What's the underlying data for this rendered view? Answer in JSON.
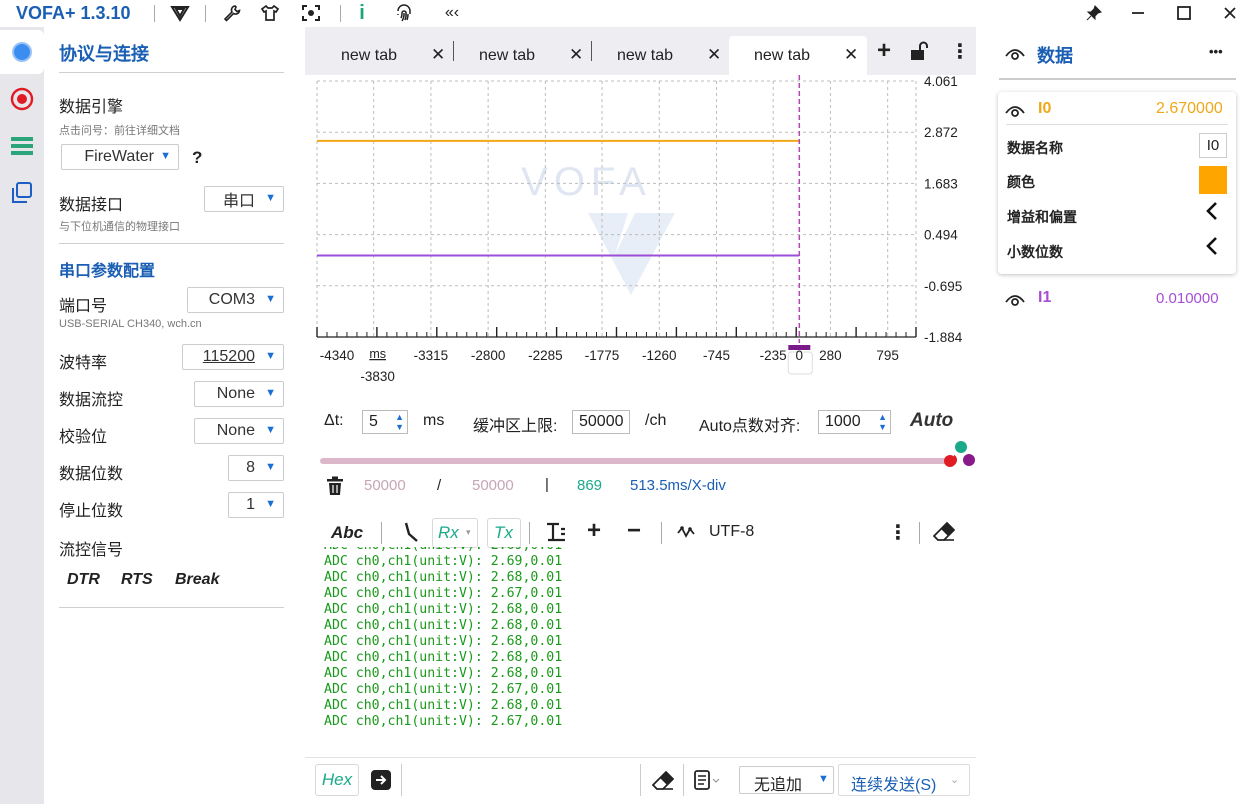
{
  "app": {
    "title": "VOFA+ 1.3.10"
  },
  "window": {
    "pin_icon": "pin-icon",
    "minimize_icon": "minimize-icon",
    "maximize_icon": "maximize-icon",
    "close_icon": "close-icon"
  },
  "left": {
    "section_title": "协议与连接",
    "engine_label": "数据引擎",
    "engine_hint": "点击问号：前往详细文档",
    "engine_value": "FireWater",
    "engine_help": "?",
    "interface_label": "数据接口",
    "interface_value": "串口",
    "interface_hint": "与下位机通信的物理接口",
    "serial_section": "串口参数配置",
    "port_label": "端口号",
    "port_value": "COM3",
    "port_hint": "USB-SERIAL CH340, wch.cn",
    "baud_label": "波特率",
    "baud_value": "115200",
    "flow_label": "数据流控",
    "flow_value": "None",
    "parity_label": "校验位",
    "parity_value": "None",
    "databits_label": "数据位数",
    "databits_value": "8",
    "stopbits_label": "停止位数",
    "stopbits_value": "1",
    "signal_label": "流控信号",
    "signals": [
      "DTR",
      "RTS",
      "Break"
    ]
  },
  "tabs": [
    {
      "label": "new tab",
      "active": false
    },
    {
      "label": "new tab",
      "active": false
    },
    {
      "label": "new tab",
      "active": false
    },
    {
      "label": "new tab",
      "active": true
    }
  ],
  "tab_actions": {
    "add": "+",
    "lock_icon": "unlock-icon",
    "more": "⋮"
  },
  "chart_data": {
    "type": "line",
    "watermark": "VOFA",
    "xlabel": "ms",
    "x_ticks": [
      "-4340",
      "-3830",
      "-3315",
      "-2800",
      "-2285",
      "-1775",
      "-1260",
      "-745",
      "-235",
      "0",
      "280",
      "795"
    ],
    "y_ticks": [
      "4.061",
      "2.872",
      "1.683",
      "0.494",
      "-0.695",
      "-1.884"
    ],
    "ylim": [
      -1.884,
      4.061
    ],
    "xlim": [
      -4340,
      1050
    ],
    "cursor_x": 0,
    "grid": true,
    "series": [
      {
        "name": "I0",
        "color": "#f0a818",
        "x": [
          -4340,
          0
        ],
        "values": [
          2.67,
          2.67
        ]
      },
      {
        "name": "I1",
        "color": "#9b4fd6",
        "x": [
          -4340,
          0
        ],
        "values": [
          0.01,
          0.01
        ]
      }
    ]
  },
  "controls": {
    "dt_label": "Δt:",
    "dt_value": "5",
    "dt_unit": "ms",
    "buffer_label": "缓冲区上限:",
    "buffer_value": "50000",
    "buffer_unit": "/ch",
    "auto_label": "Auto点数对齐:",
    "auto_value": "1000",
    "auto_button": "Auto"
  },
  "stats": {
    "count_a": "50000",
    "slash": "/",
    "count_b": "50000",
    "bar": "|",
    "points": "869",
    "rate": "513.5ms/X-div"
  },
  "console_toolbar": {
    "abc": "Abc",
    "rx": "Rx",
    "tx": "Tx",
    "plus": "+",
    "minus": "−",
    "encoding": "UTF-8"
  },
  "console": {
    "lines": [
      "ADC ch0,ch1(unit:V): 2.69,0.01",
      "ADC ch0,ch1(unit:V): 2.68,0.01",
      "ADC ch0,ch1(unit:V): 2.67,0.01",
      "ADC ch0,ch1(unit:V): 2.68,0.01",
      "ADC ch0,ch1(unit:V): 2.68,0.01",
      "ADC ch0,ch1(unit:V): 2.68,0.01",
      "ADC ch0,ch1(unit:V): 2.68,0.01",
      "ADC ch0,ch1(unit:V): 2.68,0.01",
      "ADC ch0,ch1(unit:V): 2.67,0.01",
      "ADC ch0,ch1(unit:V): 2.68,0.01",
      "ADC ch0,ch1(unit:V): 2.67,0.01"
    ]
  },
  "bottom": {
    "hex": "Hex",
    "append_value": "无追加",
    "send_button": "连续发送(S)"
  },
  "right": {
    "title": "数据",
    "more": "•••",
    "channels": [
      {
        "name": "I0",
        "value": "2.670000",
        "color": "#f0a818"
      },
      {
        "name": "I1",
        "value": "0.010000",
        "color": "#a64fd6"
      }
    ],
    "detail": {
      "name_label": "数据名称",
      "name_value": "I0",
      "color_label": "颜色",
      "color_value": "#ffa500",
      "gain_label": "增益和偏置",
      "decimals_label": "小数位数"
    }
  }
}
